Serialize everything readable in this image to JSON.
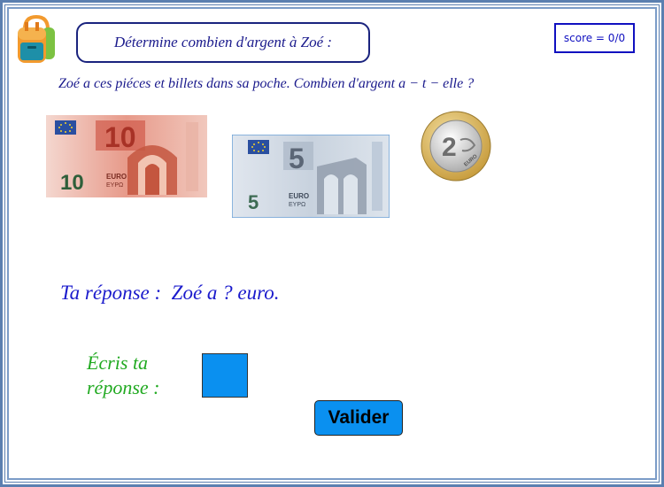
{
  "header": {
    "title": "Détermine combien d'argent à Zoé :",
    "score": "score = 0/0"
  },
  "question": "Zoé a ces piéces et billets dans sa poche. Combien d'argent a − t − elle ?",
  "money": [
    {
      "icon": "ten-euro-banknote",
      "value_text": "10"
    },
    {
      "icon": "five-euro-banknote",
      "value_text": "5"
    },
    {
      "icon": "two-euro-coin",
      "value_text": "2"
    }
  ],
  "answer_line": "Ta réponse :  Zoé a ? euro.",
  "input": {
    "label_line1": "Écris ta",
    "label_line2": "réponse :",
    "value": ""
  },
  "validate_label": "Valider",
  "colors": {
    "title_text": "#1a1a8c",
    "answer_text": "#1a1acc",
    "label_text": "#22aa22",
    "button_bg": "#0a90f0",
    "frame": "#5b7fb0"
  }
}
